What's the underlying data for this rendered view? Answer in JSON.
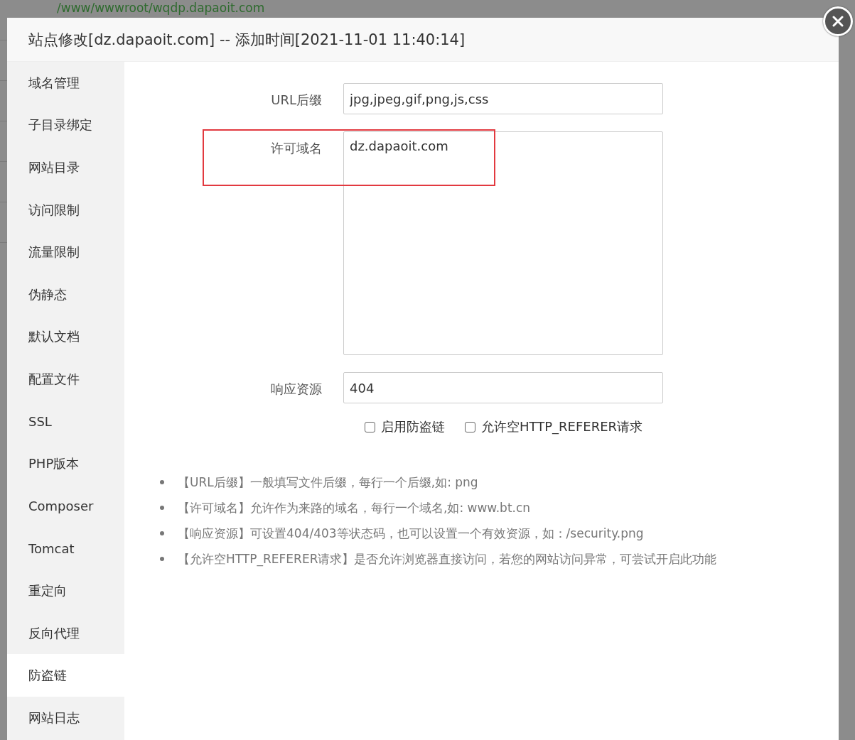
{
  "background_page": {
    "path_text": "/www/wwwroot/wqdp.dapaoit.com"
  },
  "dialog": {
    "title": "站点修改[dz.dapaoit.com] -- 添加时间[2021-11-01 11:40:14]",
    "sidebar": {
      "items": [
        {
          "label": "域名管理",
          "selected": false
        },
        {
          "label": "子目录绑定",
          "selected": false
        },
        {
          "label": "网站目录",
          "selected": false
        },
        {
          "label": "访问限制",
          "selected": false
        },
        {
          "label": "流量限制",
          "selected": false
        },
        {
          "label": "伪静态",
          "selected": false
        },
        {
          "label": "默认文档",
          "selected": false
        },
        {
          "label": "配置文件",
          "selected": false
        },
        {
          "label": "SSL",
          "selected": false
        },
        {
          "label": "PHP版本",
          "selected": false
        },
        {
          "label": "Composer",
          "selected": false
        },
        {
          "label": "Tomcat",
          "selected": false
        },
        {
          "label": "重定向",
          "selected": false
        },
        {
          "label": "反向代理",
          "selected": false
        },
        {
          "label": "防盗链",
          "selected": true
        },
        {
          "label": "网站日志",
          "selected": false
        }
      ]
    },
    "form": {
      "fields": [
        {
          "kind": "input",
          "label": "URL后缀",
          "value": "jpg,jpeg,gif,png,js,css"
        },
        {
          "kind": "textarea",
          "label": "许可域名",
          "value": "dz.dapaoit.com"
        },
        {
          "kind": "input",
          "label": "响应资源",
          "value": "404"
        }
      ],
      "checkboxes": [
        {
          "label": "启用防盗链",
          "checked": false
        },
        {
          "label": "允许空HTTP_REFERER请求",
          "checked": false
        }
      ]
    },
    "tips": [
      "【URL后缀】一般填写文件后缀，每行一个后缀,如: png",
      "【许可域名】允许作为来路的域名，每行一个域名,如: www.bt.cn",
      "【响应资源】可设置404/403等状态码，也可以设置一个有效资源，如：/security.png",
      "【允许空HTTP_REFERER请求】是否允许浏览器直接访问，若您的网站访问异常，可尝试开启此功能"
    ]
  }
}
